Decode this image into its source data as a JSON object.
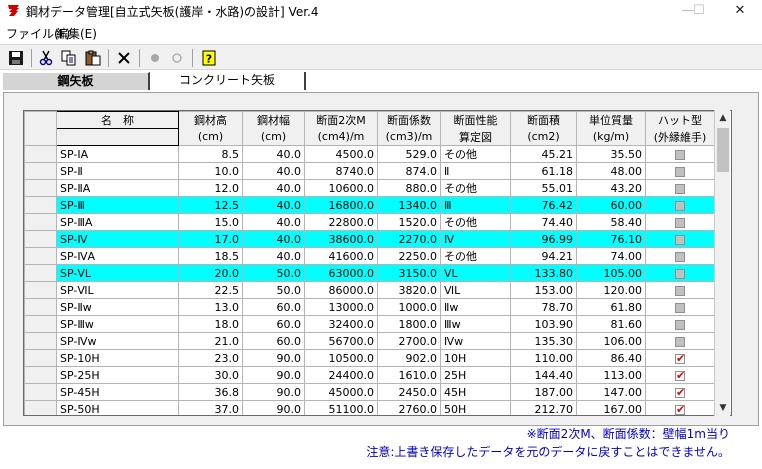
{
  "window": {
    "title": "鋼材データ管理[自立式矢板(護岸・水路)の設計] Ver.4",
    "min_glyph": "—",
    "max_glyph": "☐",
    "close_glyph": "✕"
  },
  "menu": {
    "file": "ファイル(F)",
    "edit": "編集(E)"
  },
  "toolbar": {
    "icons": [
      "save-icon",
      "cut-icon",
      "copy-icon",
      "paste-icon",
      "delete-icon",
      "record-icon",
      "circle-icon",
      "help-icon"
    ]
  },
  "tabs": [
    {
      "label": "鋼矢板",
      "active": true
    },
    {
      "label": "コンクリート矢板",
      "active": false
    }
  ],
  "grid": {
    "headers_top": [
      "名　称",
      "鋼材高",
      "鋼材幅",
      "断面2次M",
      "断面係数",
      "断面性能",
      "断面積",
      "単位質量",
      "ハット型"
    ],
    "headers_bottom": [
      "",
      "(cm)",
      "(cm)",
      "(cm4)/m",
      "(cm3)/m",
      "算定図",
      "(cm2)",
      "(kg/m)",
      "(外縁維手)"
    ],
    "rows": [
      {
        "name": "SP-ⅠA",
        "height": "8.5",
        "width": "40.0",
        "moment": "4500.0",
        "modulus": "529.0",
        "chart": "その他",
        "area": "45.21",
        "mass": "35.50",
        "hat": false,
        "hl": false
      },
      {
        "name": "SP-Ⅱ",
        "height": "10.0",
        "width": "40.0",
        "moment": "8740.0",
        "modulus": "874.0",
        "chart": "Ⅱ",
        "area": "61.18",
        "mass": "48.00",
        "hat": false,
        "hl": false
      },
      {
        "name": "SP-ⅡA",
        "height": "12.0",
        "width": "40.0",
        "moment": "10600.0",
        "modulus": "880.0",
        "chart": "その他",
        "area": "55.01",
        "mass": "43.20",
        "hat": false,
        "hl": false
      },
      {
        "name": "SP-Ⅲ",
        "height": "12.5",
        "width": "40.0",
        "moment": "16800.0",
        "modulus": "1340.0",
        "chart": "Ⅲ",
        "area": "76.42",
        "mass": "60.00",
        "hat": false,
        "hl": true
      },
      {
        "name": "SP-ⅢA",
        "height": "15.0",
        "width": "40.0",
        "moment": "22800.0",
        "modulus": "1520.0",
        "chart": "その他",
        "area": "74.40",
        "mass": "58.40",
        "hat": false,
        "hl": false
      },
      {
        "name": "SP-Ⅳ",
        "height": "17.0",
        "width": "40.0",
        "moment": "38600.0",
        "modulus": "2270.0",
        "chart": "Ⅳ",
        "area": "96.99",
        "mass": "76.10",
        "hat": false,
        "hl": true
      },
      {
        "name": "SP-ⅣA",
        "height": "18.5",
        "width": "40.0",
        "moment": "41600.0",
        "modulus": "2250.0",
        "chart": "その他",
        "area": "94.21",
        "mass": "74.00",
        "hat": false,
        "hl": false
      },
      {
        "name": "SP-ⅤL",
        "height": "20.0",
        "width": "50.0",
        "moment": "63000.0",
        "modulus": "3150.0",
        "chart": "ⅤL",
        "area": "133.80",
        "mass": "105.00",
        "hat": false,
        "hl": true
      },
      {
        "name": "SP-ⅥL",
        "height": "22.5",
        "width": "50.0",
        "moment": "86000.0",
        "modulus": "3820.0",
        "chart": "ⅥL",
        "area": "153.00",
        "mass": "120.00",
        "hat": false,
        "hl": false
      },
      {
        "name": "SP-Ⅱw",
        "height": "13.0",
        "width": "60.0",
        "moment": "13000.0",
        "modulus": "1000.0",
        "chart": "Ⅱw",
        "area": "78.70",
        "mass": "61.80",
        "hat": false,
        "hl": false
      },
      {
        "name": "SP-Ⅲw",
        "height": "18.0",
        "width": "60.0",
        "moment": "32400.0",
        "modulus": "1800.0",
        "chart": "Ⅲw",
        "area": "103.90",
        "mass": "81.60",
        "hat": false,
        "hl": false
      },
      {
        "name": "SP-Ⅳw",
        "height": "21.0",
        "width": "60.0",
        "moment": "56700.0",
        "modulus": "2700.0",
        "chart": "Ⅳw",
        "area": "135.30",
        "mass": "106.00",
        "hat": false,
        "hl": false
      },
      {
        "name": "SP-10H",
        "height": "23.0",
        "width": "90.0",
        "moment": "10500.0",
        "modulus": "902.0",
        "chart": "10H",
        "area": "110.00",
        "mass": "86.40",
        "hat": true,
        "hl": false
      },
      {
        "name": "SP-25H",
        "height": "30.0",
        "width": "90.0",
        "moment": "24400.0",
        "modulus": "1610.0",
        "chart": "25H",
        "area": "144.40",
        "mass": "113.00",
        "hat": true,
        "hl": false
      },
      {
        "name": "SP-45H",
        "height": "36.8",
        "width": "90.0",
        "moment": "45000.0",
        "modulus": "2450.0",
        "chart": "45H",
        "area": "187.00",
        "mass": "147.00",
        "hat": true,
        "hl": false
      },
      {
        "name": "SP-50H",
        "height": "37.0",
        "width": "90.0",
        "moment": "51100.0",
        "modulus": "2760.0",
        "chart": "50H",
        "area": "212.70",
        "mass": "167.00",
        "hat": true,
        "hl": false
      }
    ]
  },
  "scroll": {
    "up": "▲",
    "down": "▼"
  },
  "notes": {
    "line1": "※断面2次M、断面係数：壁幅1m当り",
    "line2": "注意:上書き保存したデータを元のデータに戻すことはできません。"
  },
  "colors": {
    "highlight": "#00ffff",
    "note": "#0000cc",
    "check": "#e00000"
  }
}
